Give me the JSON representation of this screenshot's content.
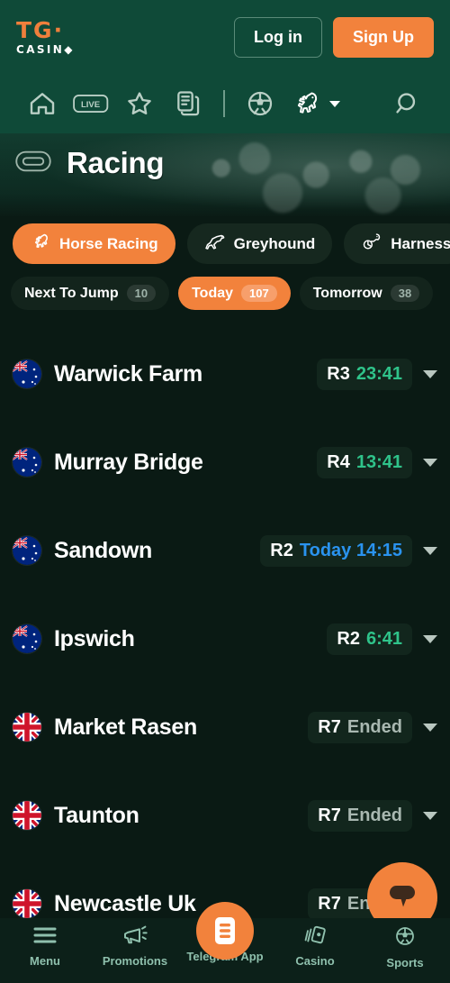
{
  "header": {
    "logo_primary": "TG·",
    "logo_secondary": "CASIN◆",
    "login_label": "Log in",
    "signup_label": "Sign Up"
  },
  "icon_nav": {
    "items": [
      {
        "name": "home-icon",
        "label": "Home"
      },
      {
        "name": "live-icon",
        "label": "LIVE"
      },
      {
        "name": "star-icon",
        "label": "Favourites"
      },
      {
        "name": "bet-slip-icon",
        "label": "Bet Slip"
      },
      {
        "name": "football-icon",
        "label": "Football"
      },
      {
        "name": "horse-racing-icon",
        "label": "Racing"
      },
      {
        "name": "search-icon",
        "label": "Search"
      }
    ]
  },
  "banner": {
    "title": "Racing",
    "icon": "race-track-icon"
  },
  "discipline_tabs": [
    {
      "label": "Horse Racing",
      "icon": "horse-icon",
      "active": true
    },
    {
      "label": "Greyhound",
      "icon": "greyhound-icon",
      "active": false
    },
    {
      "label": "Harness",
      "icon": "harness-icon",
      "active": false
    }
  ],
  "time_filters": [
    {
      "label": "Next To Jump",
      "count": "10",
      "active": false
    },
    {
      "label": "Today",
      "count": "107",
      "active": true
    },
    {
      "label": "Tomorrow",
      "count": "38",
      "active": false
    }
  ],
  "races": [
    {
      "flag": "au",
      "venue": "Warwick Farm",
      "race": "R3",
      "time": "23:41",
      "state": "countdown"
    },
    {
      "flag": "au",
      "venue": "Murray Bridge",
      "race": "R4",
      "time": "13:41",
      "state": "countdown"
    },
    {
      "flag": "au",
      "venue": "Sandown",
      "race": "R2",
      "time": "Today 14:15",
      "state": "scheduled"
    },
    {
      "flag": "au",
      "venue": "Ipswich",
      "race": "R2",
      "time": "6:41",
      "state": "countdown"
    },
    {
      "flag": "gb",
      "venue": "Market Rasen",
      "race": "R7",
      "time": "Ended",
      "state": "ended"
    },
    {
      "flag": "gb",
      "venue": "Taunton",
      "race": "R7",
      "time": "Ended",
      "state": "ended"
    },
    {
      "flag": "gb",
      "venue": "Newcastle Uk",
      "race": "R7",
      "time": "Ended",
      "state": "ended"
    }
  ],
  "chat": {
    "icon": "chat-bubble-icon"
  },
  "bottom_nav": [
    {
      "label": "Menu",
      "icon": "hamburger-icon"
    },
    {
      "label": "Promotions",
      "icon": "megaphone-icon"
    },
    {
      "label": "Telegram App",
      "icon": "telegram-app-icon",
      "center": true
    },
    {
      "label": "Casino",
      "icon": "cards-icon"
    },
    {
      "label": "Sports",
      "icon": "football-icon"
    }
  ],
  "colors": {
    "header_green": "#0f4a38",
    "body_dark": "#0a1a14",
    "accent_orange": "#f2823c",
    "time_green": "#2fc38a",
    "time_blue": "#2a93ef",
    "muted": "#a9b8b1"
  }
}
